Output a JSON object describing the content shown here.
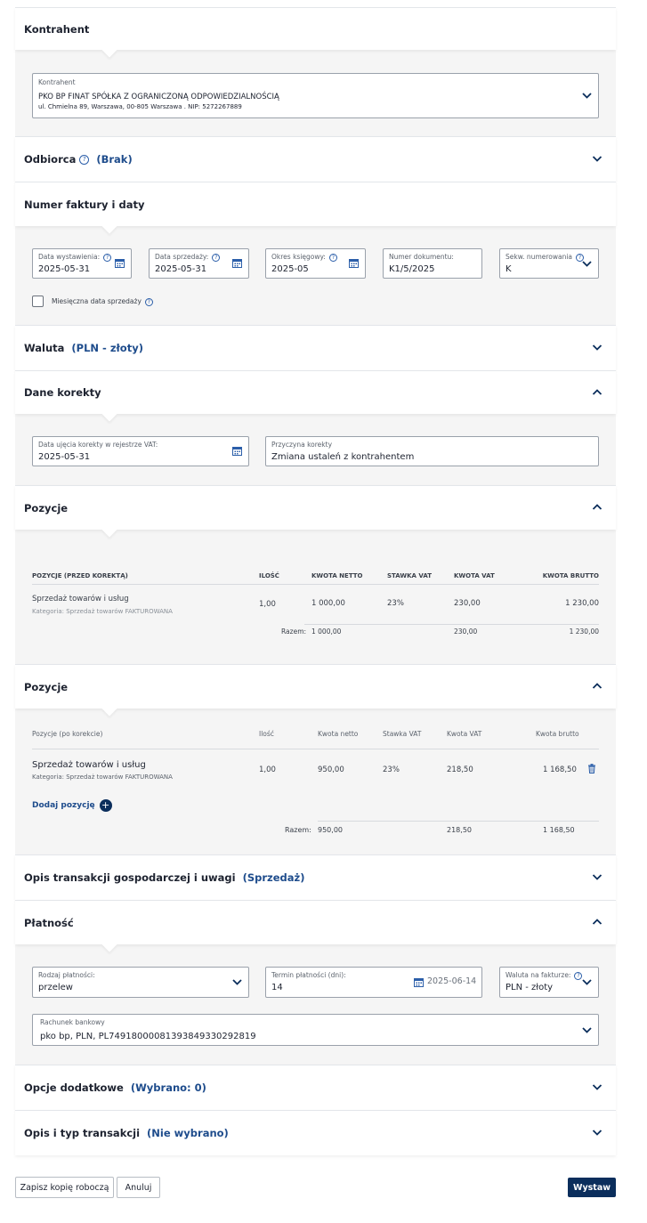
{
  "sections": {
    "kontrahent": {
      "title": "Kontrahent"
    },
    "odbiorca": {
      "title": "Odbiorca",
      "value": "(Brak)"
    },
    "numer": {
      "title": "Numer faktury i daty"
    },
    "waluta": {
      "title": "Waluta",
      "value": "(PLN - złoty)"
    },
    "dane_korekty": {
      "title": "Dane korekty"
    },
    "pozycje_przed": {
      "title": "Pozycje"
    },
    "pozycje_po": {
      "title": "Pozycje"
    },
    "opis_transakcji": {
      "title": "Opis transakcji gospodarczej i uwagi",
      "value": "(Sprzedaż)"
    },
    "platnosc": {
      "title": "Płatność"
    },
    "opcje": {
      "title": "Opcje dodatkowe",
      "value": "(Wybrano: 0)"
    },
    "opis_typ": {
      "title": "Opis i typ transakcji",
      "value": "(Nie wybrano)"
    }
  },
  "kontrahent": {
    "label": "Kontrahent",
    "name": "PKO BP FINAT SPÓŁKA Z OGRANICZONĄ ODPOWIEDZIALNOŚCIĄ",
    "address": "ul. Chmielna 89, Warszawa, 00-805 Warszawa . NIP: 5272267889"
  },
  "dates": {
    "data_wystawienia": {
      "label": "Data wystawienia:",
      "value": "2025-05-31"
    },
    "data_sprzedazy": {
      "label": "Data sprzedaży:",
      "value": "2025-05-31"
    },
    "okres": {
      "label": "Okres księgowy:",
      "value": "2025-05"
    },
    "numer_dok": {
      "label": "Numer dokumentu:",
      "value": "K1/5/2025"
    },
    "sekw": {
      "label": "Sekw. numerowania",
      "value": "K"
    },
    "miesieczna": {
      "label": "Miesięczna data sprzedaży",
      "checked": false
    }
  },
  "korekta": {
    "data_ujecia": {
      "label": "Data ujęcia korekty w rejestrze VAT:",
      "value": "2025-05-31"
    },
    "przyczyna": {
      "label": "Przyczyna korekty",
      "value": "Zmiana ustaleń z kontrahentem"
    }
  },
  "pozycje_przed": {
    "headers": [
      "POZYCJE (PRZED KOREKTĄ)",
      "ILOŚĆ",
      "KWOTA NETTO",
      "STAWKA VAT",
      "KWOTA VAT",
      "KWOTA BRUTTO"
    ],
    "row": {
      "name": "Sprzedaż towarów i usług",
      "category": "Kategoria: Sprzedaż towarów FAKTUROWANA",
      "ilosc": "1,00",
      "netto": "1 000,00",
      "stawka": "23%",
      "vat": "230,00",
      "brutto": "1 230,00"
    },
    "razem": {
      "label": "Razem:",
      "netto": "1 000,00",
      "vat": "230,00",
      "brutto": "1 230,00"
    }
  },
  "pozycje_po": {
    "headers": [
      "Pozycje (po korekcie)",
      "Ilość",
      "Kwota netto",
      "Stawka VAT",
      "Kwota VAT",
      "Kwota brutto"
    ],
    "row": {
      "name": "Sprzedaż towarów i usług",
      "category": "Kategoria: Sprzedaż towarów FAKTUROWANA",
      "ilosc": "1,00",
      "netto": "950,00",
      "stawka": "23%",
      "vat": "218,50",
      "brutto": "1 168,50"
    },
    "add_label": "Dodaj pozycję",
    "razem": {
      "label": "Razem:",
      "netto": "950,00",
      "vat": "218,50",
      "brutto": "1 168,50"
    }
  },
  "platnosc": {
    "rodzaj": {
      "label": "Rodzaj płatności:",
      "value": "przelew"
    },
    "termin": {
      "label": "Termin płatności (dni):",
      "value": "14",
      "date": "2025-06-14"
    },
    "waluta": {
      "label": "Waluta na fakturze:",
      "value": "PLN - złoty"
    },
    "rachunek": {
      "label": "Rachunek bankowy",
      "value": "pko bp, PLN, PL74918000081393849330292819"
    }
  },
  "footer": {
    "draft": "Zapisz kopię roboczą",
    "cancel": "Anuluj",
    "issue": "Wystaw"
  },
  "colors": {
    "accent": "#1e4c8c",
    "primary_button": "#0b2e5c",
    "panel_bg": "#f5f5f5"
  }
}
